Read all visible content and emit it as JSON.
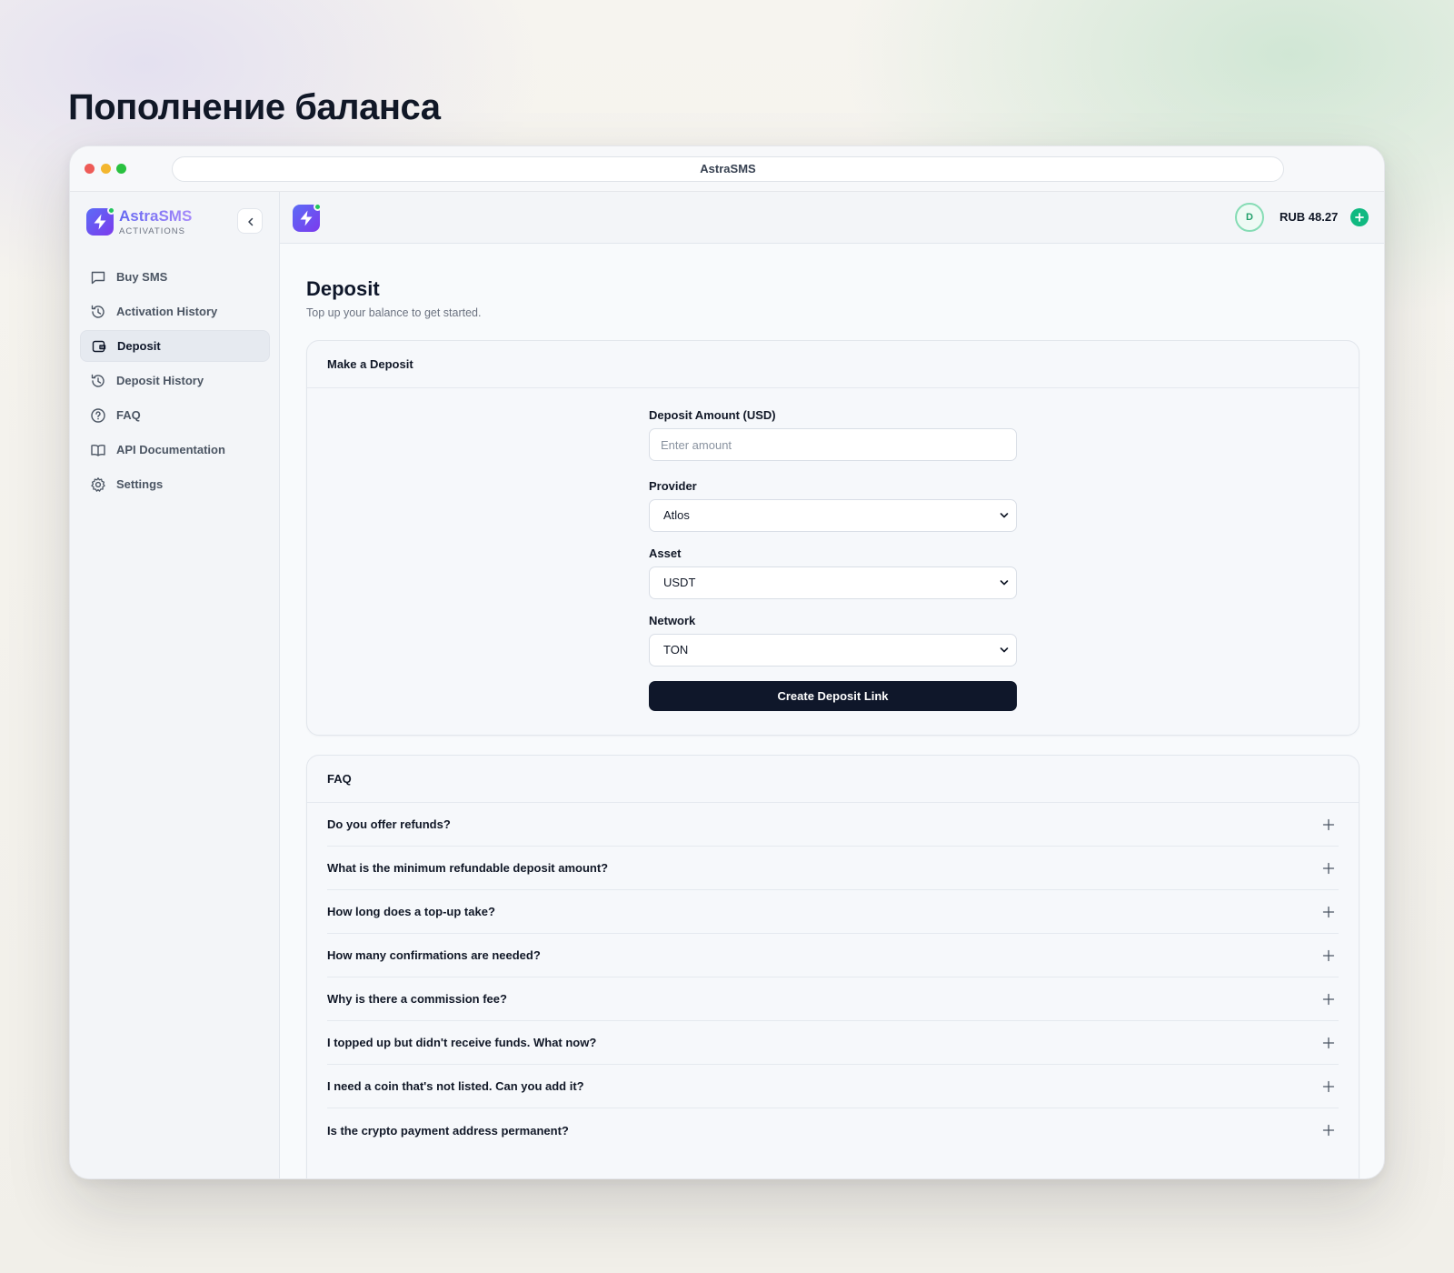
{
  "heading": "Пополнение баланса",
  "window": {
    "url_title": "AstraSMS"
  },
  "brand": {
    "name": "AstraSMS",
    "subtitle": "ACTIVATIONS"
  },
  "sidebar": {
    "items": [
      {
        "label": "Buy SMS",
        "icon": "message-square-icon"
      },
      {
        "label": "Activation History",
        "icon": "history-icon"
      },
      {
        "label": "Deposit",
        "icon": "wallet-icon",
        "active": true
      },
      {
        "label": "Deposit History",
        "icon": "history-icon"
      },
      {
        "label": "FAQ",
        "icon": "help-circle-icon"
      },
      {
        "label": "API Documentation",
        "icon": "book-open-icon"
      },
      {
        "label": "Settings",
        "icon": "gear-icon"
      }
    ]
  },
  "topbar": {
    "avatar_initial": "D",
    "balance": "RUB 48.27"
  },
  "page": {
    "title": "Deposit",
    "subtitle": "Top up your balance to get started."
  },
  "deposit": {
    "card_title": "Make a Deposit",
    "amount_label": "Deposit Amount (USD)",
    "amount_placeholder": "Enter amount",
    "amount_value": "",
    "provider_label": "Provider",
    "provider_value": "Atlos",
    "asset_label": "Asset",
    "asset_value": "USDT",
    "network_label": "Network",
    "network_value": "TON",
    "submit_label": "Create Deposit Link"
  },
  "faq": {
    "card_title": "FAQ",
    "items": [
      "Do you offer refunds?",
      "What is the minimum refundable deposit amount?",
      "How long does a top-up take?",
      "How many confirmations are needed?",
      "Why is there a commission fee?",
      "I topped up but didn't receive funds. What now?",
      "I need a coin that's not listed. Can you add it?",
      "Is the crypto payment address permanent?"
    ]
  },
  "colors": {
    "accent": "#6366f1",
    "primary_button": "#0f172a",
    "success": "#10b981",
    "page_background": "#f8fafc"
  }
}
